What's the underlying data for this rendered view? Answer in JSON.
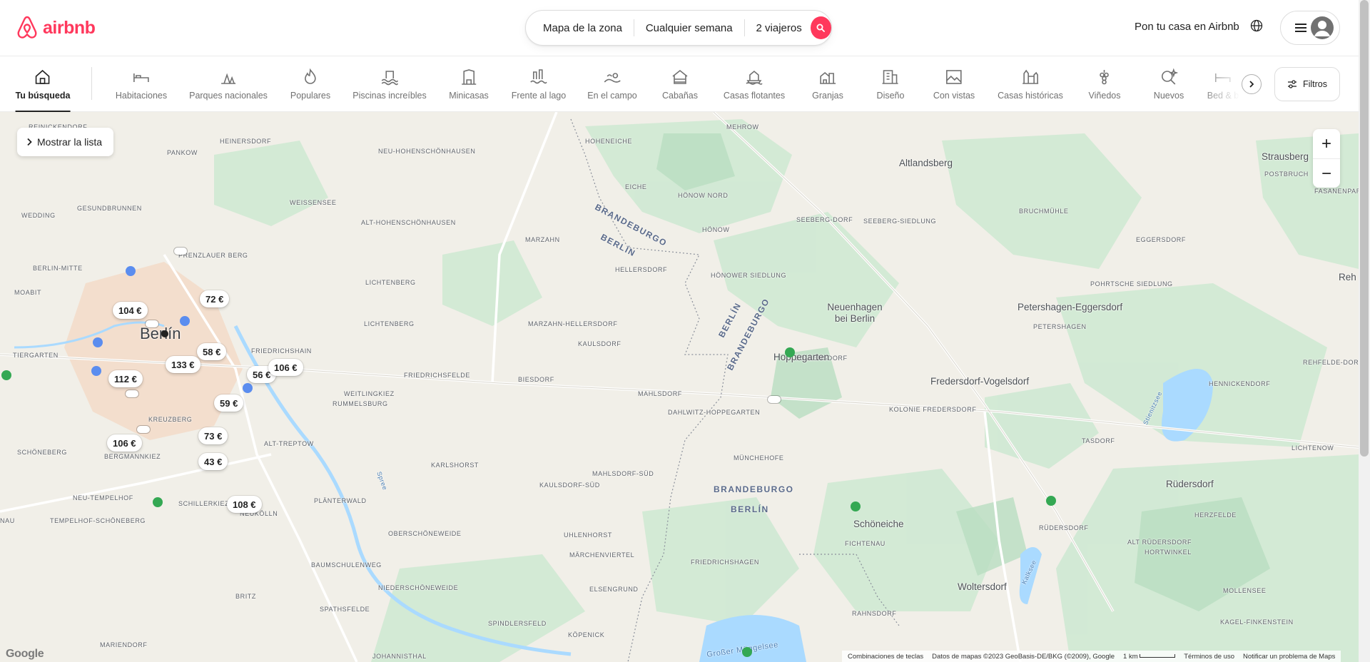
{
  "header": {
    "logo_text": "airbnb",
    "search": {
      "location": "Mapa de la zona",
      "dates": "Cualquier semana",
      "guests": "2 viajeros"
    },
    "host_link": "Pon tu casa en Airbnb",
    "brand_color": "#FF385C"
  },
  "categories": {
    "items": [
      {
        "label": "Tu búsqueda",
        "icon": "house-icon",
        "active": true
      },
      {
        "label": "Habitaciones",
        "icon": "bed-icon"
      },
      {
        "label": "Parques nacionales",
        "icon": "park-icon"
      },
      {
        "label": "Populares",
        "icon": "flame-icon"
      },
      {
        "label": "Piscinas increíbles",
        "icon": "pool-icon"
      },
      {
        "label": "Minicasas",
        "icon": "tiny-house-icon"
      },
      {
        "label": "Frente al lago",
        "icon": "lake-icon"
      },
      {
        "label": "En el campo",
        "icon": "countryside-icon"
      },
      {
        "label": "Cabañas",
        "icon": "cabin-icon"
      },
      {
        "label": "Casas flotantes",
        "icon": "houseboat-icon"
      },
      {
        "label": "Granjas",
        "icon": "farm-icon"
      },
      {
        "label": "Diseño",
        "icon": "design-icon"
      },
      {
        "label": "Con vistas",
        "icon": "views-icon"
      },
      {
        "label": "Casas históricas",
        "icon": "historic-icon"
      },
      {
        "label": "Viñedos",
        "icon": "vineyard-icon"
      },
      {
        "label": "Nuevos",
        "icon": "new-icon"
      },
      {
        "label": "Bed & b",
        "icon": "bnb-icon"
      }
    ],
    "filters_label": "Filtros"
  },
  "map": {
    "show_list_label": "Mostrar la lista",
    "zoom_in": "+",
    "zoom_out": "−",
    "prices": [
      "104 €",
      "72 €",
      "58 €",
      "133 €",
      "112 €",
      "56 €",
      "106 €",
      "59 €",
      "73 €",
      "106 €",
      "43 €",
      "108 €"
    ],
    "city": "Berlín",
    "towns": [
      "Altlandsberg",
      "Strausberg",
      "Neuenhagen bei Berlin",
      "Hoppegarten",
      "Petershagen-Eggersdorf",
      "Fredersdorf-Vogelsdorf",
      "Rüdersdorf",
      "Schöneiche",
      "Woltersdorf",
      "Reh"
    ],
    "districts": [
      "Reinickendorf",
      "Pankow",
      "Heinersdorf",
      "Neu-Hohenschönhausen",
      "Hoheneiche",
      "Mehrow",
      "Wedding",
      "Gesundbrunnen",
      "Weissensee",
      "Alt-Hohenschönhausen",
      "Eiche",
      "Hönow Nord",
      "Hönow",
      "Seeberg-Dorf",
      "Seeberg-Siedlung",
      "Bruchmühle",
      "Postbruch",
      "Fasanenpark",
      "Berlin-Mitte",
      "Prenzlauer Berg",
      "Marzahn",
      "Hellersdorf",
      "Hönower Siedlung",
      "Eggersdorf",
      "Moabit",
      "Lichtenberg",
      "Pohrtsche Siedlung",
      "Petershagen",
      "Lichtenberg",
      "Marzahn-Hellersdorf",
      "Kaulsdorf",
      "Bollensdorf",
      "Rehfelde-Dorf",
      "Tiergarten",
      "Friedrichshain",
      "Friedrichsfelde",
      "Biesdorf",
      "Mahlsdorf",
      "Hennickendorf",
      "Weitlingkiez",
      "Rummelsburg",
      "Dahlwitz-Hoppegarten",
      "Kolonie Fredersdorf",
      "Kreuzberg",
      "Tasdorf",
      "Schöneberg",
      "Bergmannkiez",
      "Alt-Treptow",
      "Karlshorst",
      "Münchehofe",
      "Lichtenow",
      "Mahlsdorf-Süd",
      "Kaulsdorf-Süd",
      "Neu-Tempelhof",
      "Schillerkiez",
      "Plänterwald",
      "Herzfelde",
      "Tempelhof-Schöneberg",
      "Neukölln",
      "Oberschöneweide",
      "Uhlenhorst",
      "Rüdersdorf",
      "Alt Rüdersdorf",
      "Hortwinkel",
      "Märchenviertel",
      "Friedrichshagen",
      "Fichtenau",
      "Baumschulenweg",
      "Niederschöneweide",
      "Elsengrund",
      "Mollensee",
      "Britz",
      "Spathsfelde",
      "Rahnsdorf",
      "Kagel-Finkenstein",
      "Spindlersfeld",
      "Mariendorf",
      "Köpenick",
      "Johannisthal",
      "Nau"
    ],
    "borders": [
      "BRANDEBURGO",
      "BERLÍN",
      "BERLÍN",
      "BRANDEBURGO",
      "BRANDEBURGO",
      "BERLÍN"
    ],
    "water": [
      "Stienitzsee",
      "Kalksee",
      "Großer Müggelsee",
      "Spree"
    ],
    "footer": [
      "Combinaciones de teclas",
      "Datos de mapas ©2023 GeoBasis-DE/BKG (©2009), Google",
      "1 km",
      "Términos de uso",
      "Notificar un problema de Maps"
    ],
    "google_logo": "Google"
  }
}
